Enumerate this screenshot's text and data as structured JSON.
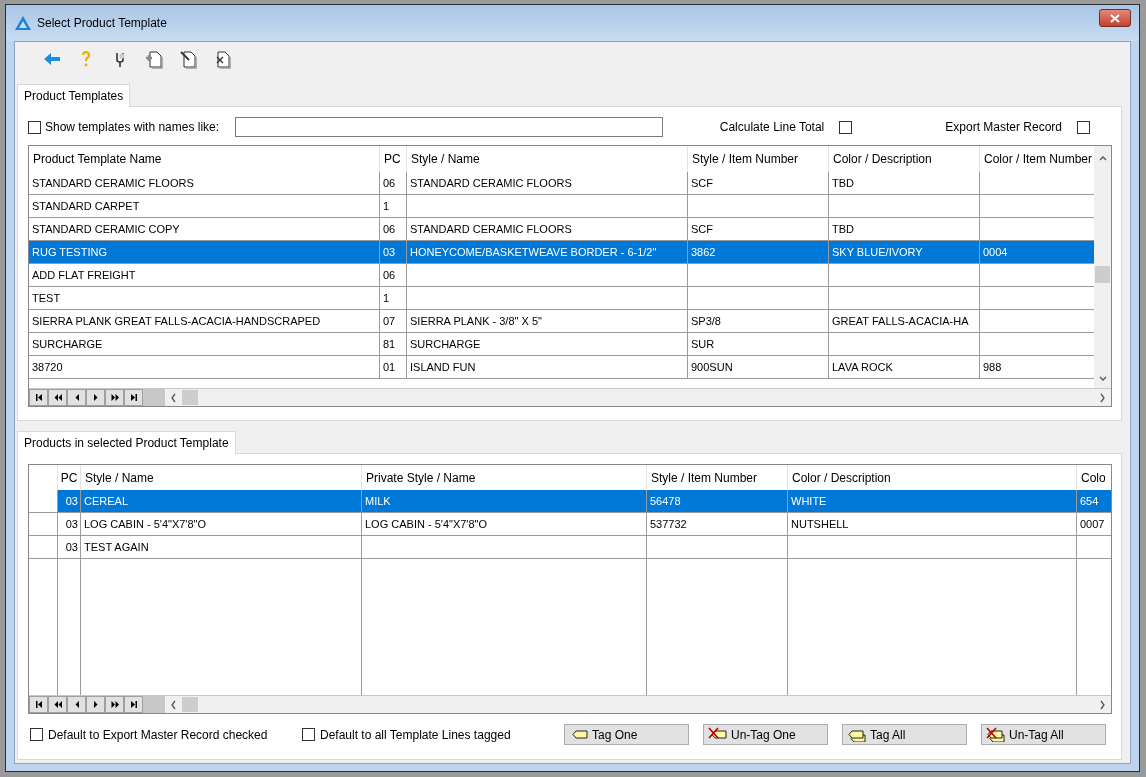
{
  "window": {
    "title": "Select Product Template"
  },
  "templates_panel": {
    "tab": {
      "label": "Product Templates",
      "selected": true
    },
    "filter": {
      "label": "Show templates with names like:",
      "checked": false
    },
    "calculate_line_total": {
      "label": "Calculate Line Total",
      "checked": false
    },
    "export_master_record": {
      "label": "Export Master Record",
      "checked": false
    },
    "table": {
      "columns": [
        "Product Template Name",
        "PC",
        "Style / Name",
        "Style / Item Number",
        "Color / Description",
        "Color / Item Number"
      ],
      "rows": [
        {
          "cells": [
            "STANDARD CERAMIC FLOORS",
            "06",
            "STANDARD CERAMIC FLOORS",
            "SCF",
            "TBD",
            ""
          ],
          "selected": false
        },
        {
          "cells": [
            "STANDARD CARPET",
            "1",
            "",
            "",
            "",
            ""
          ],
          "selected": false
        },
        {
          "cells": [
            "STANDARD CERAMIC COPY",
            "06",
            "STANDARD CERAMIC FLOORS",
            "SCF",
            "TBD",
            ""
          ],
          "selected": false
        },
        {
          "cells": [
            "RUG TESTING",
            "03",
            "HONEYCOME/BASKETWEAVE BORDER - 6-1/2\"",
            "3862",
            "SKY BLUE/IVORY",
            "0004"
          ],
          "selected": true
        },
        {
          "cells": [
            "ADD FLAT FREIGHT",
            "06",
            "",
            "",
            "",
            ""
          ],
          "selected": false
        },
        {
          "cells": [
            "TEST",
            "1",
            "",
            "",
            "",
            ""
          ],
          "selected": false
        },
        {
          "cells": [
            "SIERRA PLANK GREAT FALLS-ACACIA-HANDSCRAPED",
            "07",
            "SIERRA PLANK - 3/8\" X 5\"",
            "SP3/8",
            "GREAT FALLS-ACACIA-HA",
            ""
          ],
          "selected": false
        },
        {
          "cells": [
            "SURCHARGE",
            "81",
            "SURCHARGE",
            "SUR",
            "",
            ""
          ],
          "selected": false
        },
        {
          "cells": [
            "38720",
            "01",
            "ISLAND FUN",
            "900SUN",
            "LAVA ROCK",
            "988"
          ],
          "selected": false
        }
      ]
    }
  },
  "products_panel": {
    "tab": {
      "label": "Products in selected Product Template",
      "selected": true
    },
    "table": {
      "columns": [
        "PC",
        "Style / Name",
        "Private Style / Name",
        "Style / Item Number",
        "Color / Description",
        "Colo"
      ],
      "rows": [
        {
          "cells": [
            "03",
            "CEREAL",
            "MILK",
            "56478",
            "WHITE",
            "654"
          ],
          "selected": true
        },
        {
          "cells": [
            "03",
            "LOG CABIN - 5'4\"X7'8\"O",
            "LOG CABIN - 5'4\"X7'8\"O",
            "537732",
            "NUTSHELL",
            "0007"
          ],
          "selected": false
        },
        {
          "cells": [
            "03",
            "TEST AGAIN",
            "",
            "",
            "",
            ""
          ],
          "selected": false
        }
      ]
    },
    "options": [
      {
        "label": "Default to Export Master Record checked",
        "checked": false
      },
      {
        "label": "Default to all Template Lines tagged",
        "checked": false
      }
    ],
    "buttons": [
      {
        "label": "Tag One",
        "kind": "tag-one"
      },
      {
        "label": "Un-Tag One",
        "kind": "untag-one"
      },
      {
        "label": "Tag All",
        "kind": "tag-all"
      },
      {
        "label": "Un-Tag All",
        "kind": "untag-all"
      }
    ]
  }
}
